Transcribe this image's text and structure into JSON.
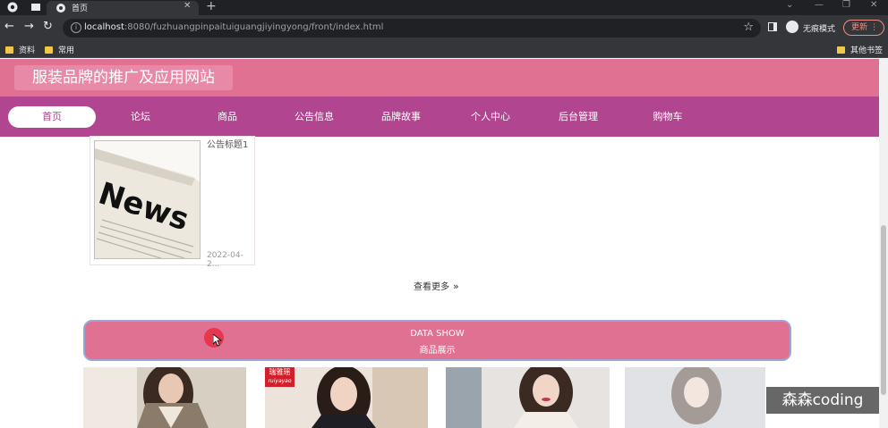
{
  "browser": {
    "tab_title": "首页",
    "url_host": "localhost",
    "url_rest": ":8080/fuzhuangpinpaituiguangjiyingyong/front/index.html",
    "incognito_label": "无痕模式",
    "update_label": "更新",
    "bookmarks": [
      "资料",
      "常用",
      "其他书签"
    ],
    "icons": [
      "back-arrow-icon",
      "forward-arrow-icon",
      "reload-icon",
      "info-icon",
      "star-icon",
      "side-panel-icon",
      "incognito-icon"
    ]
  },
  "site": {
    "title": "服装品牌的推广及应用网站",
    "nav": [
      "首页",
      "论坛",
      "商品",
      "公告信息",
      "品牌故事",
      "个人中心",
      "后台管理",
      "购物车"
    ],
    "active_nav": "首页"
  },
  "notice": {
    "title": "公告标题1",
    "date": "2022-04-2...",
    "image_text": "News"
  },
  "view_more": "查看更多",
  "section": {
    "en": "DATA SHOW",
    "zh": "商品展示"
  },
  "products": [
    {
      "label": ""
    },
    {
      "label": "瑞雅瑶",
      "label_sub": "ruiyayao"
    },
    {
      "label": ""
    },
    {
      "label": ""
    }
  ],
  "watermark": "森森coding",
  "colors": {
    "header": "#e07193",
    "nav": "#b2458f",
    "banner": "#e07193"
  }
}
